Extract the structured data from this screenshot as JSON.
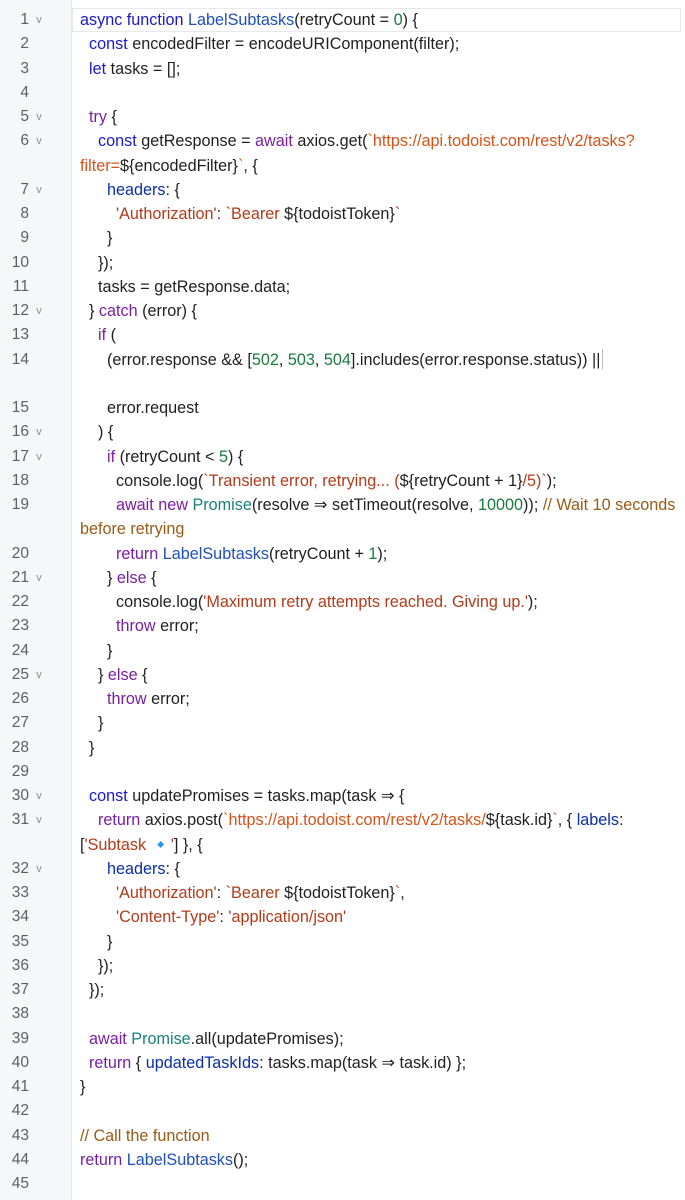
{
  "editor": {
    "lines": [
      {
        "num": "1",
        "fold": true,
        "code": "async function LabelSubtasks(retryCount = 0) {"
      },
      {
        "num": "2",
        "fold": false,
        "code": "  const encodedFilter = encodeURIComponent(filter);"
      },
      {
        "num": "3",
        "fold": false,
        "code": "  let tasks = [];"
      },
      {
        "num": "4",
        "fold": false,
        "code": ""
      },
      {
        "num": "5",
        "fold": true,
        "code": "  try {"
      },
      {
        "num": "6",
        "fold": true,
        "code": "    const getResponse = await axios.get(`https://api.todoist.com/rest/v2/tasks?filter=${encodedFilter}`, {"
      },
      {
        "num": "7",
        "fold": true,
        "code": "      headers: {"
      },
      {
        "num": "8",
        "fold": false,
        "code": "        'Authorization': `Bearer ${todoistToken}`"
      },
      {
        "num": "9",
        "fold": false,
        "code": "      }"
      },
      {
        "num": "10",
        "fold": false,
        "code": "    });"
      },
      {
        "num": "11",
        "fold": false,
        "code": "    tasks = getResponse.data;"
      },
      {
        "num": "12",
        "fold": true,
        "code": "  } catch (error) {"
      },
      {
        "num": "13",
        "fold": false,
        "code": "    if ("
      },
      {
        "num": "14",
        "fold": false,
        "code": "      (error.response && [502, 503, 504].includes(error.response.status)) ||"
      },
      {
        "num": "15",
        "fold": false,
        "code": "      error.request"
      },
      {
        "num": "16",
        "fold": true,
        "code": "    ) {"
      },
      {
        "num": "17",
        "fold": true,
        "code": "      if (retryCount < 5) {"
      },
      {
        "num": "18",
        "fold": false,
        "code": "        console.log(`Transient error, retrying... (${retryCount + 1}/5)`);"
      },
      {
        "num": "19",
        "fold": false,
        "code": "        await new Promise(resolve ⇒ setTimeout(resolve, 10000)); // Wait 10 seconds before retrying"
      },
      {
        "num": "20",
        "fold": false,
        "code": "        return LabelSubtasks(retryCount + 1);"
      },
      {
        "num": "21",
        "fold": true,
        "code": "      } else {"
      },
      {
        "num": "22",
        "fold": false,
        "code": "        console.log('Maximum retry attempts reached. Giving up.');"
      },
      {
        "num": "23",
        "fold": false,
        "code": "        throw error;"
      },
      {
        "num": "24",
        "fold": false,
        "code": "      }"
      },
      {
        "num": "25",
        "fold": true,
        "code": "    } else {"
      },
      {
        "num": "26",
        "fold": false,
        "code": "      throw error;"
      },
      {
        "num": "27",
        "fold": false,
        "code": "    }"
      },
      {
        "num": "28",
        "fold": false,
        "code": "  }"
      },
      {
        "num": "29",
        "fold": false,
        "code": ""
      },
      {
        "num": "30",
        "fold": true,
        "code": "  const updatePromises = tasks.map(task ⇒ {"
      },
      {
        "num": "31",
        "fold": true,
        "code": "    return axios.post(`https://api.todoist.com/rest/v2/tasks/${task.id}`, { labels: ['Subtask 🔹'] }, {"
      },
      {
        "num": "32",
        "fold": true,
        "code": "      headers: {"
      },
      {
        "num": "33",
        "fold": false,
        "code": "        'Authorization': `Bearer ${todoistToken}`,"
      },
      {
        "num": "34",
        "fold": false,
        "code": "        'Content-Type': 'application/json'"
      },
      {
        "num": "35",
        "fold": false,
        "code": "      }"
      },
      {
        "num": "36",
        "fold": false,
        "code": "    });"
      },
      {
        "num": "37",
        "fold": false,
        "code": "  });"
      },
      {
        "num": "38",
        "fold": false,
        "code": ""
      },
      {
        "num": "39",
        "fold": false,
        "code": "  await Promise.all(updatePromises);"
      },
      {
        "num": "40",
        "fold": false,
        "code": "  return { updatedTaskIds: tasks.map(task ⇒ task.id) };"
      },
      {
        "num": "41",
        "fold": false,
        "code": "}"
      },
      {
        "num": "42",
        "fold": false,
        "code": ""
      },
      {
        "num": "43",
        "fold": false,
        "code": "// Call the function"
      },
      {
        "num": "44",
        "fold": false,
        "code": "return LabelSubtasks();"
      },
      {
        "num": "45",
        "fold": false,
        "code": ""
      }
    ],
    "fold_glyph": "v",
    "colors": {
      "keyword": "#7a1fa2",
      "keyword2": "#1a1ac4",
      "function": "#1f4fb8",
      "string": "#b23b1a",
      "url": "#d3531a",
      "number": "#187a3c",
      "property": "#0a2ea8",
      "comment": "#9a5a15",
      "gutter_bg": "#f6f7f9"
    }
  }
}
